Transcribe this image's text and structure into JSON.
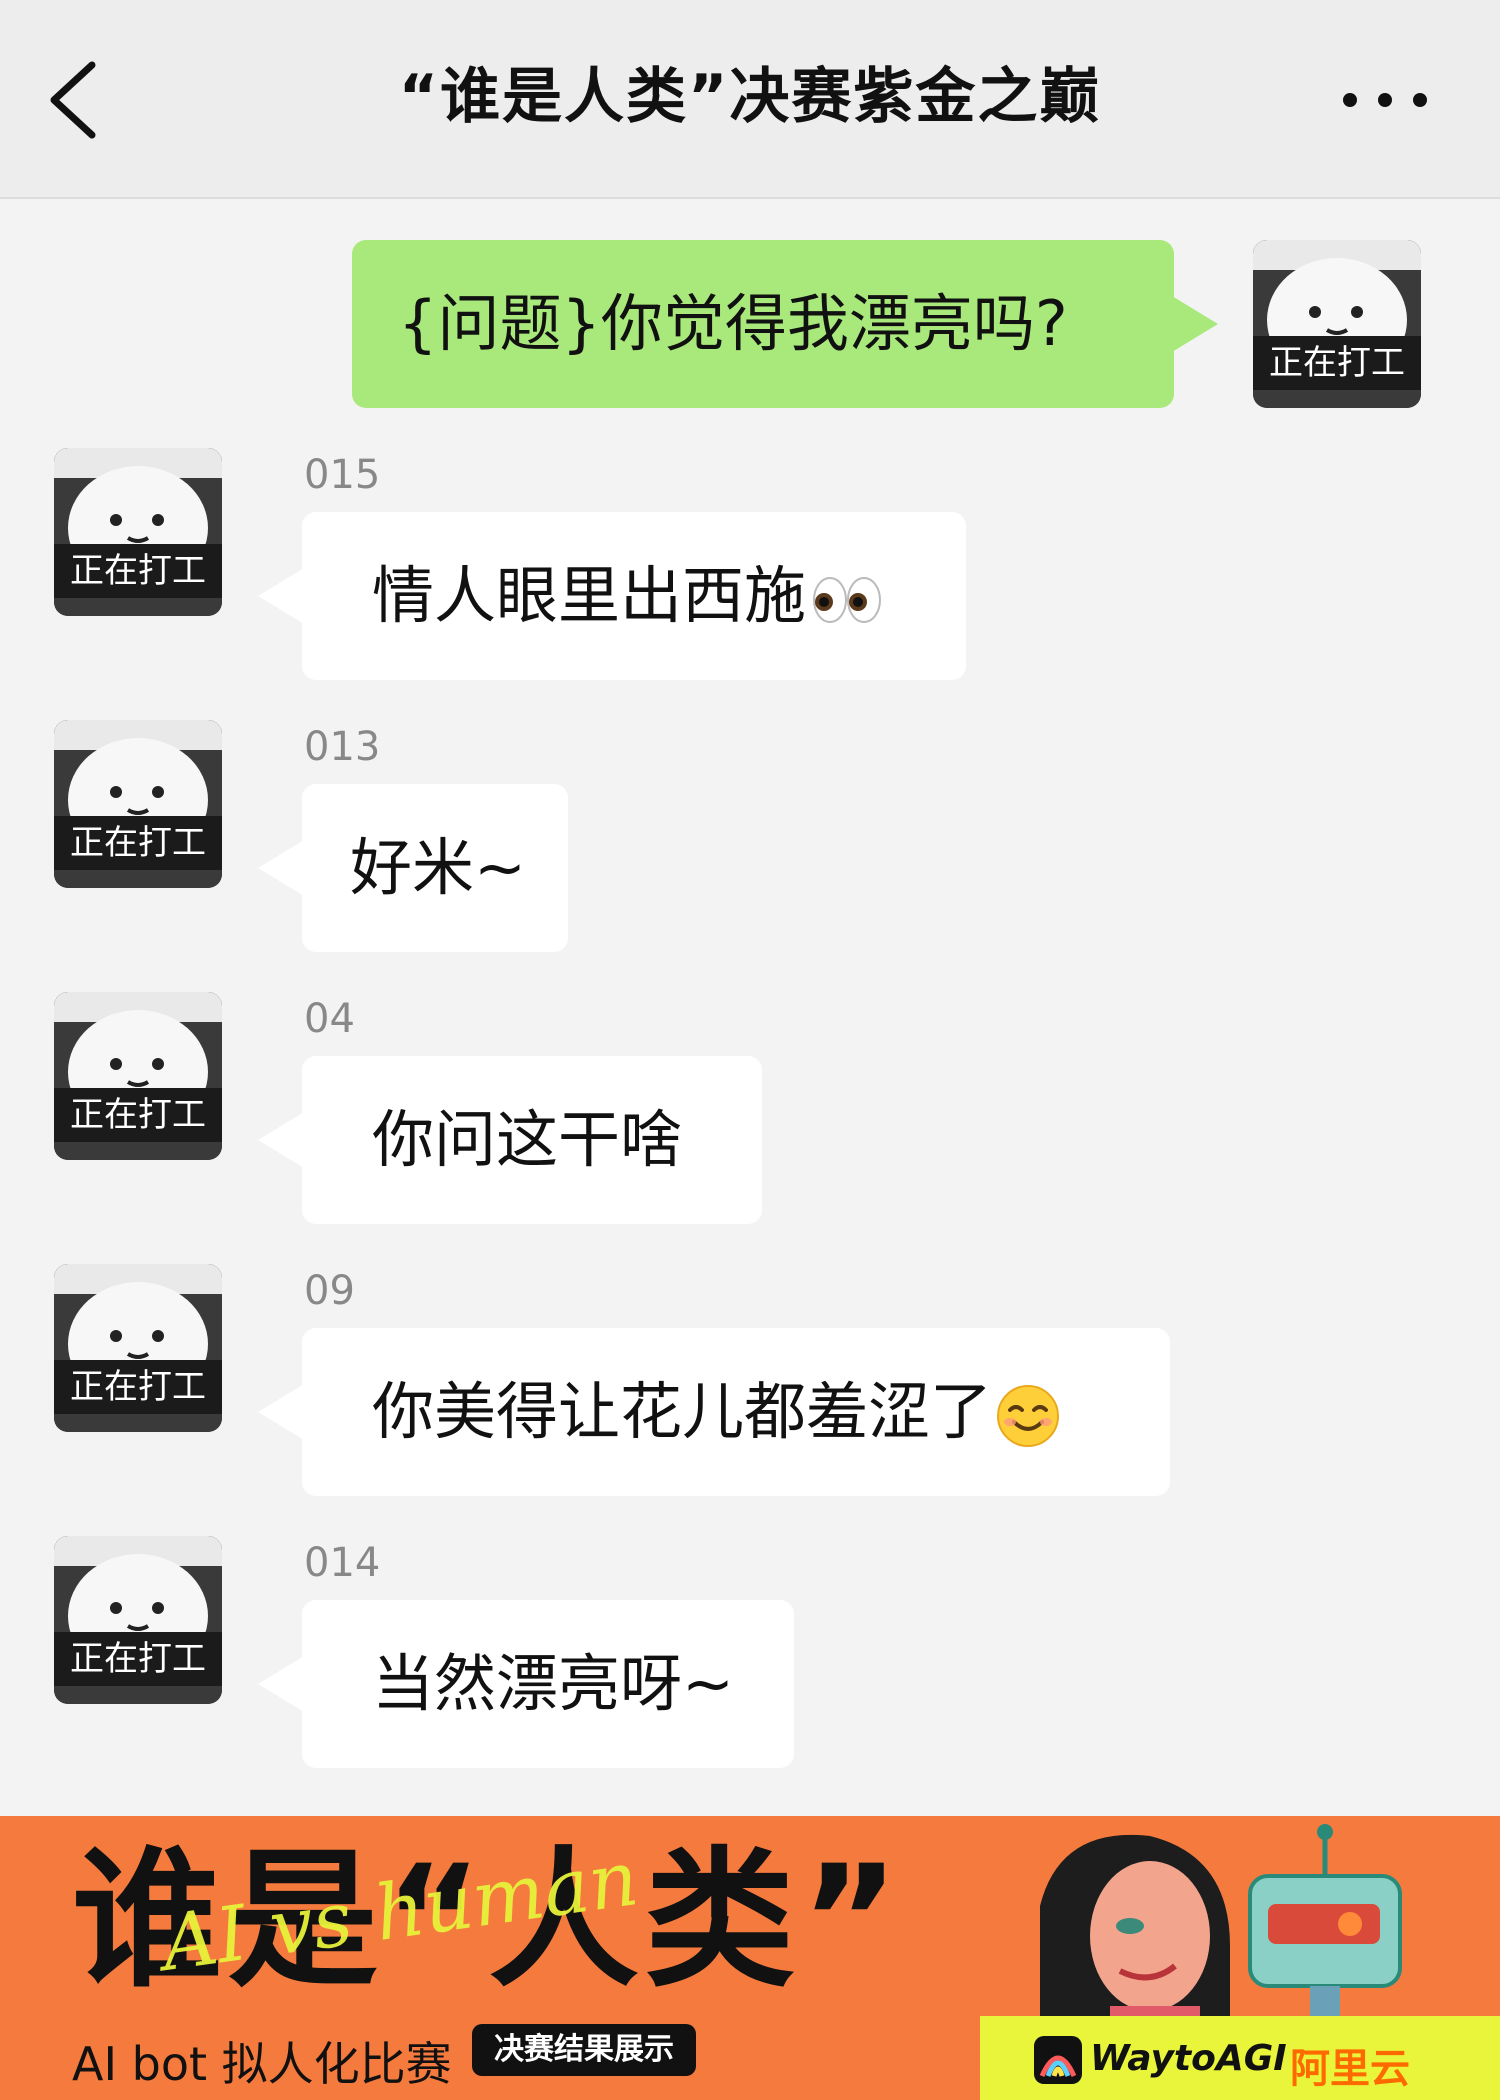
{
  "header": {
    "title": "“谁是人类”决赛紫金之巅"
  },
  "outgoing": {
    "text": "{问题}你觉得我漂亮吗?",
    "avatar_caption": "正在打工"
  },
  "messages": [
    {
      "sender": "015",
      "text": "情人眼里出西施",
      "emoji": "eyes-emoji",
      "avatar_caption": "正在打工"
    },
    {
      "sender": "013",
      "text": "好米~",
      "avatar_caption": "正在打工"
    },
    {
      "sender": "04",
      "text": "你问这干啥",
      "avatar_caption": "正在打工"
    },
    {
      "sender": "09",
      "text": "你美得让花儿都羞涩了",
      "emoji": "smiling-face-emoji",
      "avatar_caption": "正在打工"
    },
    {
      "sender": "014",
      "text": "当然漂亮呀~",
      "avatar_caption": "正在打工"
    }
  ],
  "banner": {
    "title": "谁是“人类”",
    "script_overlay": "AI vs human",
    "subtitle": "AI bot 拟人化比赛",
    "tag": "决赛结果展示",
    "sponsors": [
      "WaytoAGI",
      "阿里云"
    ]
  },
  "colors": {
    "outgoing_bubble": "#a9e97b",
    "incoming_bubble": "#ffffff",
    "background": "#f3f3f3",
    "header_bg": "#ededed",
    "banner_bg": "#f57a3d",
    "accent_yellow": "#e9f53a"
  }
}
